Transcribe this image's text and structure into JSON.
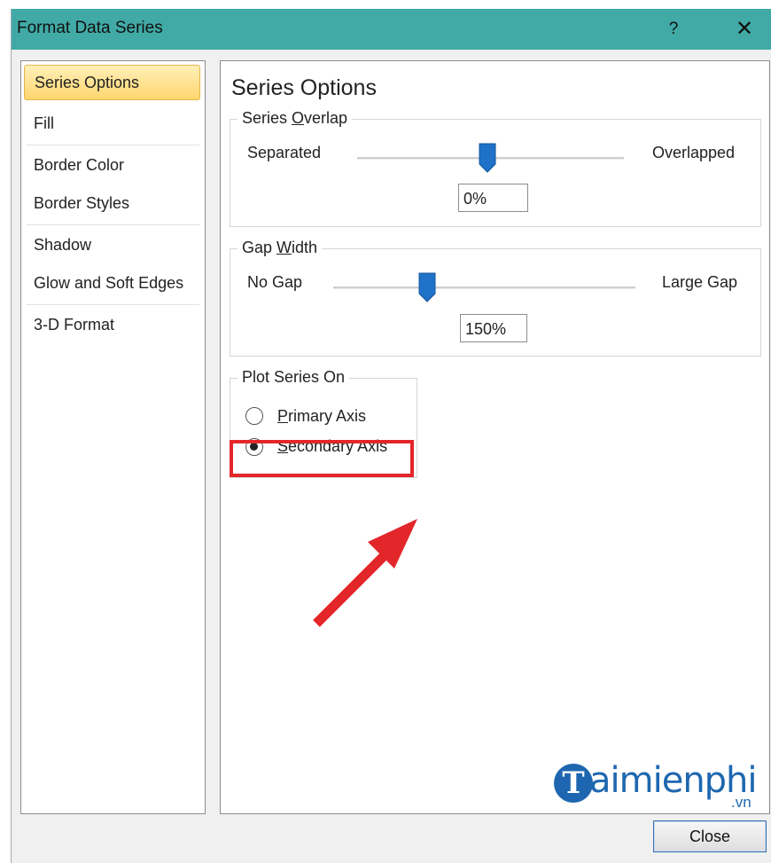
{
  "window": {
    "title": "Format Data Series",
    "help_label": "?",
    "close_label": "✕"
  },
  "nav": {
    "items": [
      {
        "label": "Series Options",
        "active": true
      },
      {
        "label": "Fill"
      },
      {
        "label": "Border Color"
      },
      {
        "label": "Border Styles"
      },
      {
        "label": "Shadow"
      },
      {
        "label": "Glow and Soft Edges"
      },
      {
        "label": "3-D Format"
      }
    ]
  },
  "panel": {
    "title": "Series Options",
    "series_overlap": {
      "label_pre": "Series ",
      "label_access": "O",
      "label_post": "verlap",
      "min_label": "Separated",
      "max_label": "Overlapped",
      "value": "0%",
      "slider_fraction": 0.49
    },
    "gap_width": {
      "label_pre": "Gap ",
      "label_access": "W",
      "label_post": "idth",
      "min_label": "No Gap",
      "max_label": "Large Gap",
      "value": "150%",
      "slider_fraction": 0.31
    },
    "plot_series_on": {
      "label": "Plot Series On",
      "options": [
        {
          "access": "P",
          "rest": "rimary Axis",
          "selected": false
        },
        {
          "access": "S",
          "rest": "econdary Axis",
          "selected": true
        }
      ]
    }
  },
  "watermark": {
    "brand_initial": "T",
    "brand_rest": "aimienphi",
    "tld": ".vn"
  },
  "footer": {
    "close_button": "Close"
  },
  "colors": {
    "titlebar": "#41aaa6",
    "accent_blue": "#1e67b0",
    "highlight_red": "#e3262a",
    "nav_active": "#ffd66e"
  }
}
